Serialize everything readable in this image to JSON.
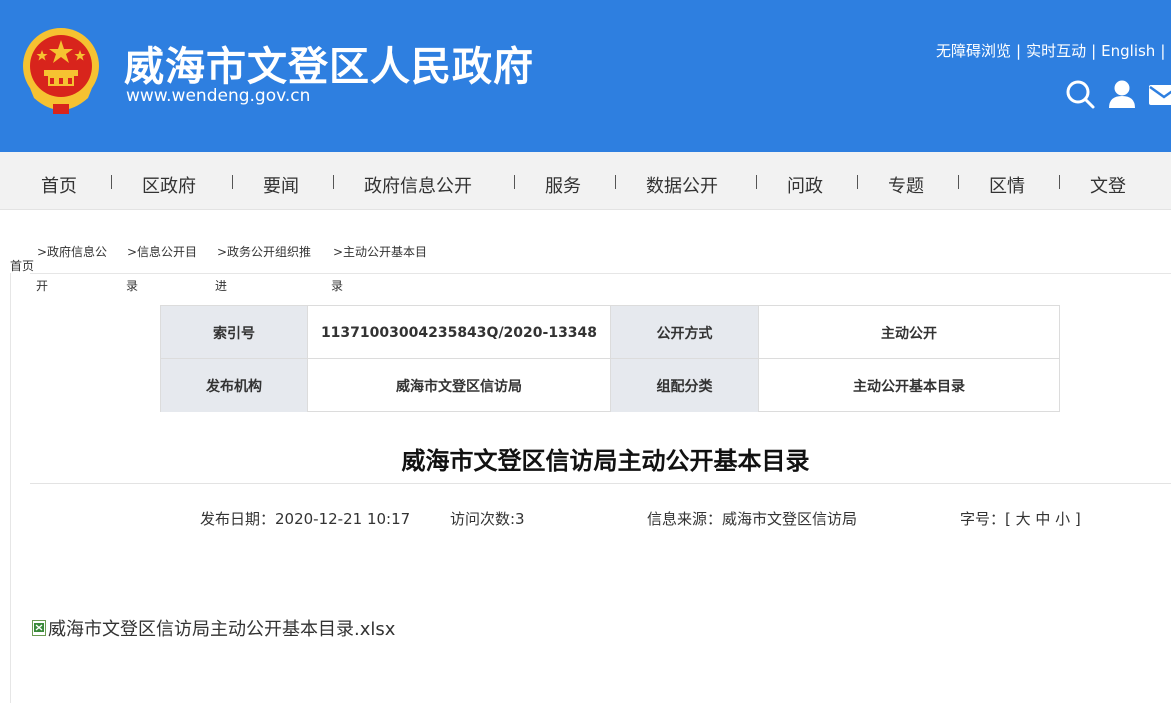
{
  "header": {
    "title": "威海市文登区人民政府",
    "url": "www.wendeng.gov.cn",
    "links": [
      "无障碍浏览",
      "实时互动",
      "English"
    ],
    "separator": "|",
    "icons": [
      "search-icon",
      "user-icon",
      "mail-icon"
    ],
    "bg_color": "#2e7fe0"
  },
  "nav": {
    "items": [
      "首页",
      "区政府",
      "要闻",
      "政府信息公开",
      "服务",
      "数据公开",
      "问政",
      "专题",
      "区情",
      "文登"
    ]
  },
  "breadcrumb": {
    "home": "首页",
    "items": [
      {
        "top": ">政府信息公",
        "bottom": "开"
      },
      {
        "top": ">信息公开目",
        "bottom": "录"
      },
      {
        "top": ">政务公开组织推",
        "bottom": "进"
      },
      {
        "top": ">主动公开基本目",
        "bottom": "录"
      }
    ]
  },
  "info": {
    "index_label": "索引号",
    "index_value": "11371003004235843Q/2020-13348",
    "method_label": "公开方式",
    "method_value": "主动公开",
    "org_label": "发布机构",
    "org_value": "威海市文登区信访局",
    "category_label": "组配分类",
    "category_value": "主动公开基本目录"
  },
  "article": {
    "title": "威海市文登区信访局主动公开基本目录",
    "date": "发布日期：2020-12-21 10:17",
    "visits": "访问次数:3",
    "source": "信息来源：威海市文登区信访局",
    "font_size": "字号：[ 大 中 小 ]",
    "attachment": "威海市文登区信访局主动公开基本目录.xlsx"
  }
}
